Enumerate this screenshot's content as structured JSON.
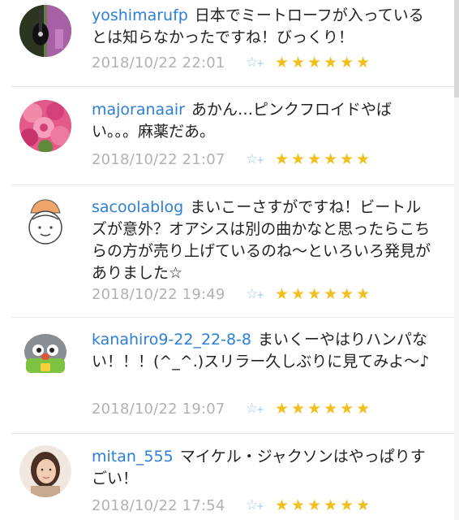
{
  "comments": [
    {
      "username": "yoshimarufp",
      "text": "日本でミートローフが入っているとは知らなかったですね！びっくり！",
      "date": "2018/10/22 22:01",
      "stars": "★★★★★★",
      "avatar_icon": "guitar-photo"
    },
    {
      "username": "majoranaair",
      "text": "あかん…ピンクフロイドやばい。。。麻薬だあ。",
      "date": "2018/10/22 21:07",
      "stars": "★★★★★★",
      "avatar_icon": "pink-roses-photo"
    },
    {
      "username": "sacoolablog",
      "text": "まいこーさすがですね！ビートルズが意外？オアシスは別の曲かなと思ったらこちらの方が売り上げているのね〜といろいろ発見がありました☆",
      "date": "2018/10/22 19:49",
      "stars": "★★★★★★",
      "avatar_icon": "cartoon-person-illustration"
    },
    {
      "username": "kanahiro9-22_22-8-8",
      "text": "まいくーやはりハンパない！！！(^_^.)スリラー久しぶりに見てみよ〜♪",
      "date": "2018/10/22 19:07",
      "stars": "★★★★★★",
      "avatar_icon": "green-robot-character"
    },
    {
      "username": "mitan_555",
      "text": "マイケル・ジャクソンはやっぱりすごい！",
      "date": "2018/10/22 17:54",
      "stars": "★★★★★★",
      "avatar_icon": "woman-portrait-photo"
    }
  ],
  "add_star_icon": "☆",
  "add_star_plus": "+",
  "colors": {
    "username": "#2b7fd6",
    "date": "#b2b2b2",
    "star": "#f1bf1e",
    "add_star": "#9ec6ea"
  }
}
